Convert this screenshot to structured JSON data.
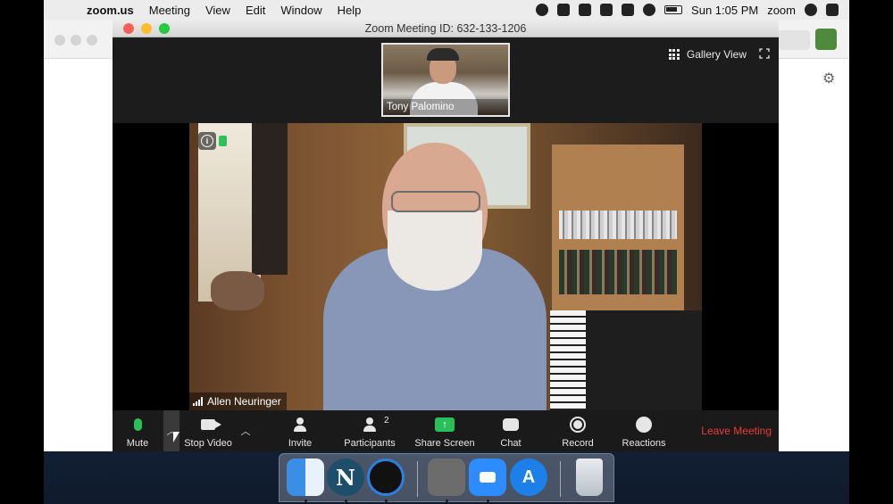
{
  "menubar": {
    "app_name": "zoom.us",
    "items": [
      "Meeting",
      "View",
      "Edit",
      "Window",
      "Help"
    ],
    "clock": "Sun 1:05 PM",
    "right_app": "zoom"
  },
  "zoom_window": {
    "title": "Zoom Meeting ID: 632-133-1206",
    "gallery_view_label": "Gallery View",
    "thumbnail_name": "Tony Palomino",
    "active_speaker_name": "Allen Neuringer"
  },
  "controls": {
    "mute": "Mute",
    "stop_video": "Stop Video",
    "invite": "Invite",
    "participants": "Participants",
    "participants_count": "2",
    "share_screen": "Share Screen",
    "chat": "Chat",
    "record": "Record",
    "reactions": "Reactions",
    "leave": "Leave Meeting"
  },
  "colors": {
    "mic_active": "#29c05a",
    "share_green": "#29c05a",
    "leave_red": "#ec3b33",
    "toolbar_bg": "#1a1a1a"
  },
  "dock": {
    "icons": [
      "finder-icon",
      "netscape-icon",
      "quicktime-icon",
      "system-preferences-icon",
      "zoom-app-icon",
      "app-store-icon",
      "trash-icon"
    ]
  }
}
